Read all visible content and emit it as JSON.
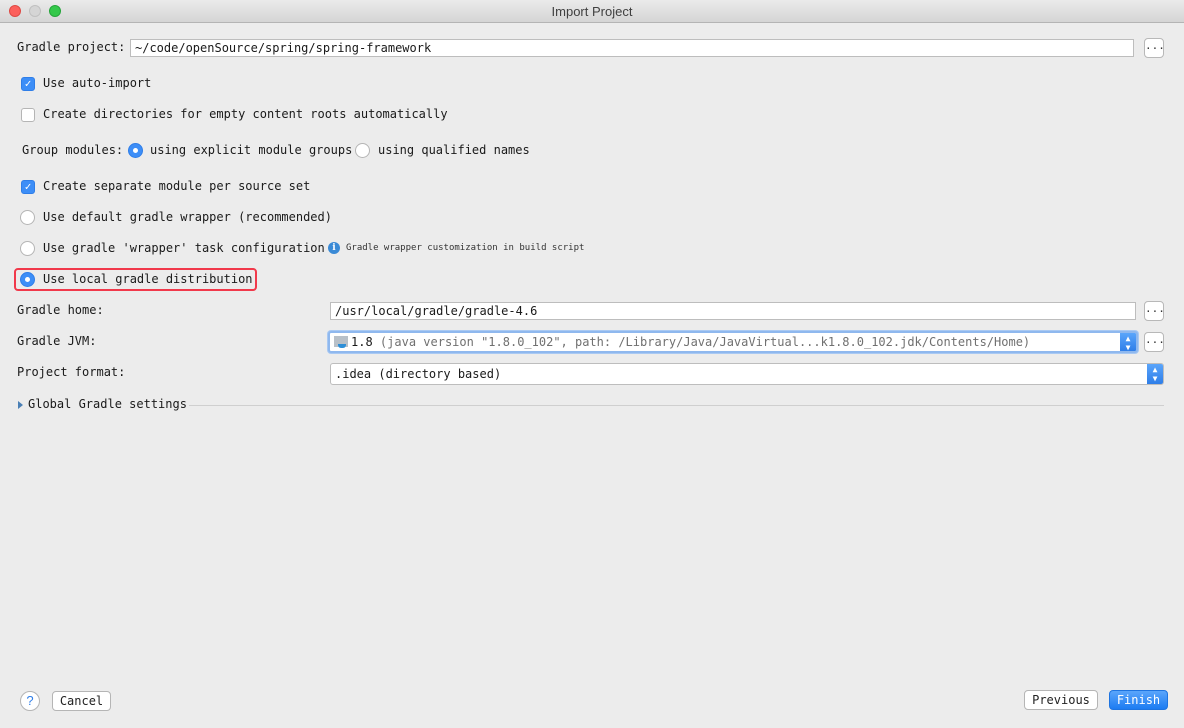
{
  "window": {
    "title": "Import Project"
  },
  "gradle_project": {
    "label": "Gradle project:",
    "value": "~/code/openSource/spring/spring-framework",
    "browse_label": "..."
  },
  "options": {
    "use_auto_import": {
      "label": "Use auto-import",
      "checked": true
    },
    "create_directories": {
      "label": "Create directories for empty content roots automatically",
      "checked": false
    },
    "group_modules": {
      "label": "Group modules:",
      "choices": [
        {
          "label": "using explicit module groups",
          "selected": true
        },
        {
          "label": "using qualified names",
          "selected": false
        }
      ]
    },
    "separate_module": {
      "label": "Create separate module per source set",
      "checked": true
    }
  },
  "distribution": {
    "choices": [
      {
        "label": "Use default gradle wrapper (recommended)",
        "selected": false
      },
      {
        "label": "Use gradle 'wrapper' task configuration",
        "selected": false,
        "note": "Gradle wrapper customization in build script"
      },
      {
        "label": "Use local gradle distribution",
        "selected": true
      }
    ]
  },
  "gradle_home": {
    "label": "Gradle home:",
    "value": "/usr/local/gradle/gradle-4.6",
    "browse_label": "..."
  },
  "gradle_jvm": {
    "label": "Gradle JVM:",
    "version": "1.8",
    "detail": "(java version \"1.8.0_102\", path: /Library/Java/JavaVirtual...k1.8.0_102.jdk/Contents/Home)",
    "browse_label": "..."
  },
  "project_format": {
    "label": "Project format:",
    "value": ".idea (directory based)"
  },
  "global_settings": {
    "label": "Global Gradle settings"
  },
  "footer": {
    "help_label": "?",
    "cancel_label": "Cancel",
    "previous_label": "Previous",
    "finish_label": "Finish"
  },
  "colors": {
    "accent": "#3d8ef7",
    "highlight_border": "#f1394b"
  }
}
